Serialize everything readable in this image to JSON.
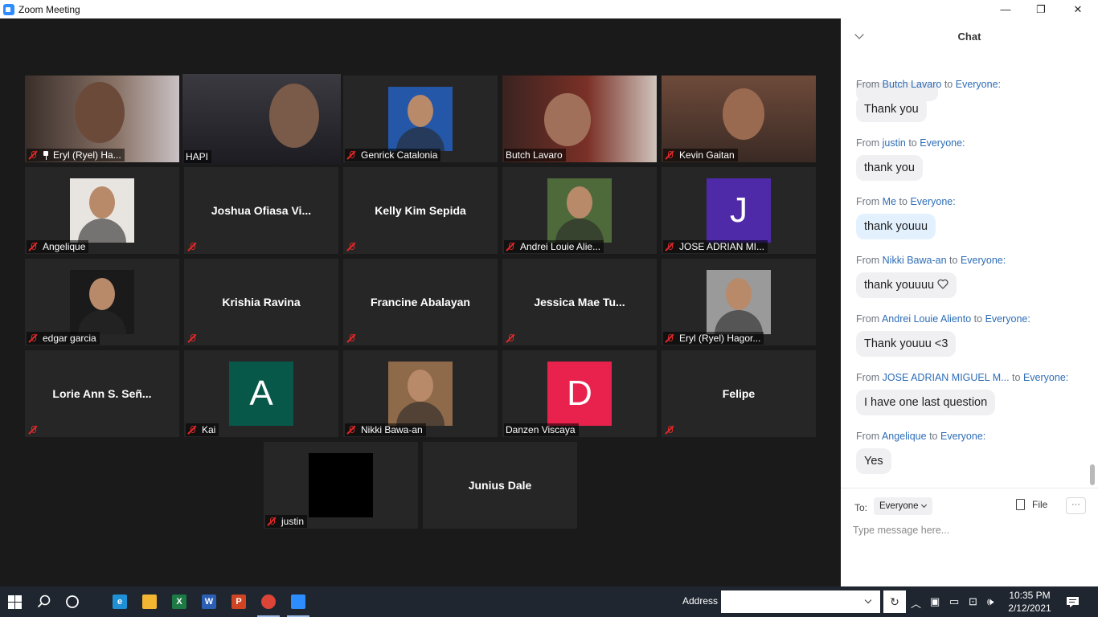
{
  "window": {
    "title": "Zoom Meeting",
    "minimize": "—",
    "restore": "❐",
    "close": "✕"
  },
  "gallery": {
    "participants": [
      {
        "name": "Eryl (Ryel) Ha...",
        "type": "video",
        "muted": true,
        "pinned": true
      },
      {
        "name": "HAPI",
        "type": "video",
        "muted": false,
        "active_speaker": true
      },
      {
        "name": "Genrick Catalonia",
        "type": "photo",
        "muted": true
      },
      {
        "name": "Butch Lavaro",
        "type": "video",
        "muted": false
      },
      {
        "name": "Kevin Gaitan",
        "type": "video",
        "muted": true
      },
      {
        "name": "Angelique",
        "type": "photo",
        "muted": true
      },
      {
        "name": "Joshua Ofiasa Vi...",
        "type": "name",
        "muted": true
      },
      {
        "name": "Kelly Kim Sepida",
        "type": "name",
        "muted": true
      },
      {
        "name": "Andrei Louie Alie...",
        "type": "photo",
        "muted": true
      },
      {
        "name": "JOSE ADRIAN MI...",
        "type": "letter",
        "letter": "J",
        "color": "#4f2aa8",
        "muted": true
      },
      {
        "name": "edgar garcia",
        "type": "photo",
        "muted": true
      },
      {
        "name": "Krishia Ravina",
        "type": "name",
        "muted": true
      },
      {
        "name": "Francine Abalayan",
        "type": "name",
        "muted": true
      },
      {
        "name": "Jessica Mae Tu...",
        "type": "name",
        "muted": true
      },
      {
        "name": "Eryl (Ryel) Hagor...",
        "type": "photo",
        "muted": true
      },
      {
        "name": "Lorie Ann S. Señ...",
        "type": "name",
        "muted": true
      },
      {
        "name": "Kai",
        "type": "letter",
        "letter": "A",
        "color": "#08584a",
        "muted": true
      },
      {
        "name": "Nikki Bawa-an",
        "type": "photo",
        "muted": true
      },
      {
        "name": "Danzen Viscaya",
        "type": "letter",
        "letter": "D",
        "color": "#e8224c",
        "muted": false
      },
      {
        "name": "Felipe",
        "type": "name",
        "muted": true
      },
      {
        "name": "justin",
        "type": "photo-black",
        "muted": true
      },
      {
        "name": "Junius Dale",
        "type": "name",
        "muted": false
      }
    ]
  },
  "chat": {
    "title": "Chat",
    "messages": [
      {
        "prefix": "From",
        "sender": "Butch Lavaro",
        "mid": "to",
        "recipient": "Everyone:",
        "text": "Thank you",
        "me": false
      },
      {
        "prefix": "From",
        "sender": "justin",
        "mid": "to",
        "recipient": "Everyone:",
        "text": "thank you",
        "me": false
      },
      {
        "prefix": "From",
        "sender": "Me",
        "mid": "to",
        "recipient": "Everyone:",
        "text": "thank youuu",
        "me": true
      },
      {
        "prefix": "From",
        "sender": "Nikki Bawa-an",
        "mid": "to",
        "recipient": "Everyone:",
        "text": "thank youuuu",
        "me": false,
        "heart": true
      },
      {
        "prefix": "From",
        "sender": "Andrei Louie Aliento",
        "mid": "to",
        "recipient": "Everyone:",
        "text": "Thank youuu <3",
        "me": false
      },
      {
        "prefix": "From",
        "sender": "JOSE ADRIAN MIGUEL M...",
        "mid": "to",
        "recipient": "Everyone:",
        "text": "I have one last question",
        "me": false
      },
      {
        "prefix": "From",
        "sender": "Angelique",
        "mid": "to",
        "recipient": "Everyone:",
        "text": "Yes",
        "me": false
      }
    ],
    "to_label": "To:",
    "to_value": "Everyone",
    "file_label": "File",
    "more_label": "···",
    "input_placeholder": "Type message here..."
  },
  "taskbar": {
    "apps": [
      {
        "name": "edge",
        "glyph": "e",
        "color": "#1f8fd6"
      },
      {
        "name": "file-explorer",
        "glyph": "",
        "color": "#f2b632"
      },
      {
        "name": "excel",
        "glyph": "X",
        "color": "#1d7a45"
      },
      {
        "name": "word",
        "glyph": "W",
        "color": "#2b5fb5"
      },
      {
        "name": "powerpoint",
        "glyph": "P",
        "color": "#d04423"
      },
      {
        "name": "chrome",
        "glyph": "",
        "color": "#db4437"
      },
      {
        "name": "zoom",
        "glyph": "",
        "color": "#2d8cff"
      }
    ],
    "address_label": "Address",
    "time": "10:35 PM",
    "date": "2/12/2021"
  }
}
